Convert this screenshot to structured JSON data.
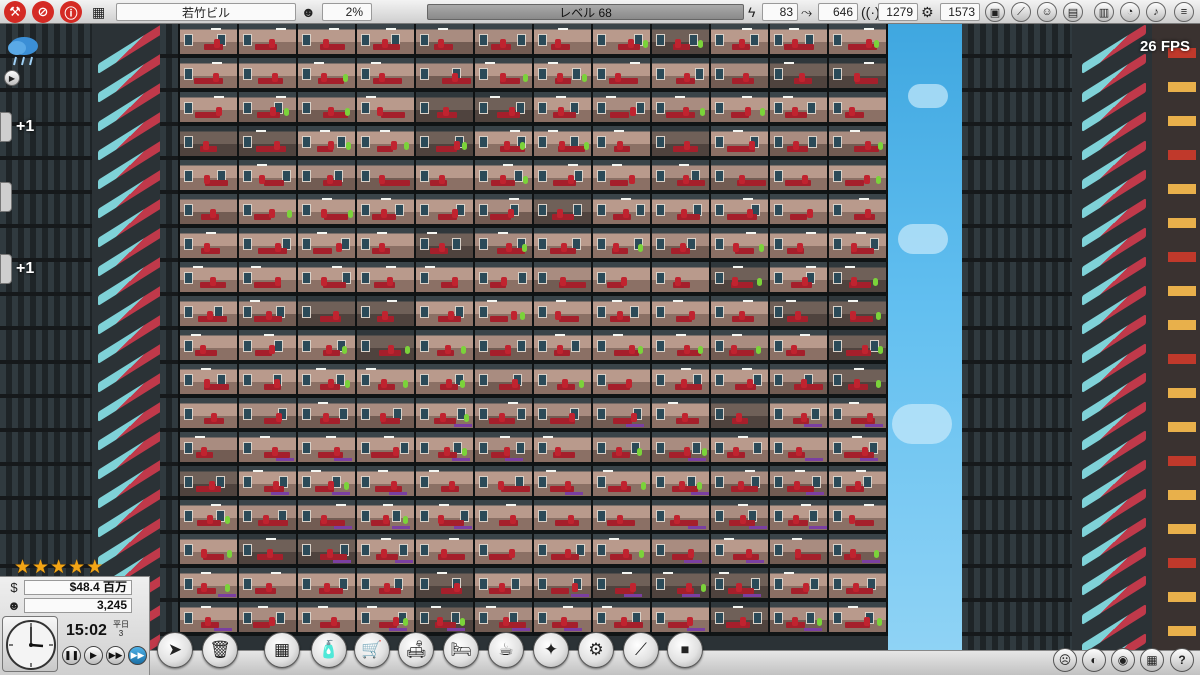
{
  "top_bar": {
    "building_name": "若竹ビル",
    "approval_percent": "2%",
    "level_label": "レベル 68",
    "stat_power": "83",
    "stat_water": "646",
    "stat_network": "1279",
    "stat_maintenance": "1573",
    "icons_left": [
      "build-hammer-icon",
      "cancel-icon",
      "info-icon"
    ],
    "icons_right": [
      "box-icon",
      "chart-line-icon",
      "people-icon",
      "layout-icon",
      "bar-chart-icon",
      "pie-chart-icon",
      "bell-icon",
      "menu-icon"
    ]
  },
  "overlay": {
    "fps": "26 FPS",
    "plus_one_a": "+1",
    "plus_one_b": "+1"
  },
  "stats": {
    "stars": 5,
    "money": "$48.4 百万",
    "population": "3,245",
    "time": "15:02",
    "day_type": "平日",
    "day_number": "3"
  },
  "speed_controls": [
    "pause",
    "play",
    "fast-forward",
    "fastest"
  ],
  "active_speed": "fastest",
  "toolbar": {
    "tools": [
      "select-cursor-icon",
      "demolish-trash-icon",
      "build-floor-icon",
      "cleaning-icon",
      "shopping-cart-icon",
      "sofa-icon",
      "bed-icon",
      "coffee-icon",
      "stars-icon",
      "settings-gear-icon",
      "stairs-icon",
      "elevator-icon"
    ],
    "right_buttons": [
      "mood-face-icon",
      "contrast-icon",
      "eye-icon",
      "grid-icon",
      "help-icon"
    ],
    "help_glyph": "?"
  },
  "colors": {
    "accent_red": "#c0232f",
    "sky_blue": "#62bff0",
    "star_gold": "#f2a516",
    "speed_active": "#1a6fa5"
  }
}
